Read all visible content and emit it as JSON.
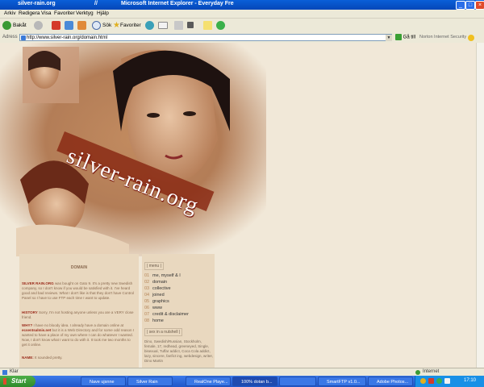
{
  "window": {
    "site_tab": "silver-rain.org",
    "title": "Microsoft Internet Explorer - Everyday Fre",
    "title_prefix": "//",
    "menu": [
      "Arkiv",
      "Redigera",
      "Visa",
      "Favoriter",
      "Verktyg",
      "Hjälp"
    ]
  },
  "toolbar": {
    "back": "Bakåt",
    "search": "Sök",
    "favorites": "Favoriter"
  },
  "address": {
    "label": "Adress",
    "url": "http://www.silver-rain.org/domain.html",
    "go": "Gå till",
    "norton": "Norton Internet Security"
  },
  "page": {
    "logo": "silver-rain.org",
    "domain_heading": "DOMAIN",
    "para1_head": "SILVER RAIN.ORG",
    "para1": "was bought on Gato 9. It's a pretty new Swedish company, so I don't know if you would be satisfied with it. I've heard good and bad reviews. What I don't like is that they don't have Control Panel so I have to use FTP each time I want to update.",
    "para2_head": "HISTORY",
    "para2": "Sorry, I'm not hosting anyone unless you are a VERY close friend.",
    "para3_head": "WHY?",
    "para3": "I have no bloody idea. I already have a domain online at",
    "para3_link": "ecsentsalmis.net",
    "para3b": "but it is a Web Directory and for some odd reason I wanted to have a place of my own where I can do whatever I wanted. Now, I don't know what I want to do with it. It took me two months to get it online.",
    "para4_head": "NAME:",
    "para4": "It sounded pretty."
  },
  "nav": {
    "section1": "| menu |",
    "items": [
      {
        "num": "01",
        "label": "me, myself & I"
      },
      {
        "num": "02",
        "label": "domain"
      },
      {
        "num": "03",
        "label": "collective"
      },
      {
        "num": "04",
        "label": "joined"
      },
      {
        "num": "05",
        "label": "graphics"
      },
      {
        "num": "06",
        "label": "www"
      },
      {
        "num": "07",
        "label": "credit & disclaimer"
      },
      {
        "num": "08",
        "label": "home"
      }
    ],
    "section2": "| sex in a nutshell |",
    "nutshell": "Dino, Swedish/Russian, Stockholm, female, 17, redhead, greeneyed, Single, bisexual, Tuffar addict, Coca Cola addict, lazy, sincere, fanfict ing, webdesign, writer, Dino Martin"
  },
  "status": {
    "left": "Klar",
    "zone": "Internet"
  },
  "taskbar": {
    "start": "Start",
    "tasks": [
      "Nave ujsnne",
      "Silver Rain",
      "RealOne Playe...",
      "100% dotan b...",
      "",
      "SmartFTP v1.0...",
      "Adobe Photos..."
    ],
    "clock": "17:10"
  },
  "colors": {
    "titlebar": "#0a5fd8",
    "chrome": "#ece9d8",
    "page_bg": "#f1e8d8",
    "column_bg": "#e9d8bf",
    "accent_red": "#9a2a1a",
    "taskbar": "#2056c8",
    "start_green": "#3aa034"
  }
}
